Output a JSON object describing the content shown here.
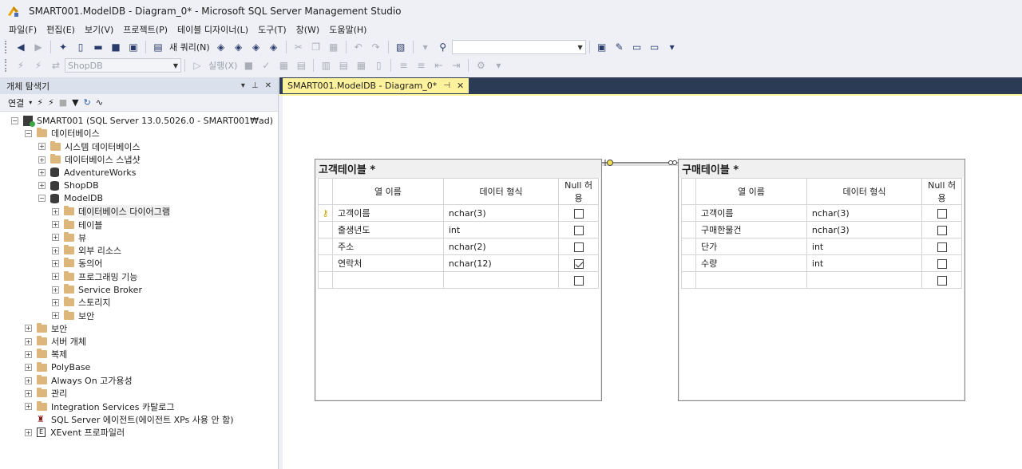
{
  "window": {
    "title": "SMART001.ModelDB - Diagram_0* - Microsoft SQL Server Management Studio"
  },
  "menu": [
    "파일(F)",
    "편집(E)",
    "보기(V)",
    "프로젝트(P)",
    "테이블 디자이너(L)",
    "도구(T)",
    "창(W)",
    "도움말(H)"
  ],
  "toolbar": {
    "new_query_label": "새 쿼리(N)",
    "database_combo": "ShopDB",
    "execute_label": "실행(X)",
    "search_value": ""
  },
  "object_explorer": {
    "title": "개체 탐색기",
    "connect_label": "연결",
    "tree": [
      {
        "label": "SMART001 (SQL Server 13.0.5026.0 - SMART001₩ad)",
        "level": 0,
        "expander": "-",
        "icon": "server-icon"
      },
      {
        "label": "데이터베이스",
        "level": 1,
        "expander": "-",
        "icon": "folder-icon"
      },
      {
        "label": "시스템 데이터베이스",
        "level": 2,
        "expander": "+",
        "icon": "folder-icon"
      },
      {
        "label": "데이터베이스 스냅샷",
        "level": 2,
        "expander": "+",
        "icon": "folder-icon"
      },
      {
        "label": "AdventureWorks",
        "level": 2,
        "expander": "+",
        "icon": "database-icon"
      },
      {
        "label": "ShopDB",
        "level": 2,
        "expander": "+",
        "icon": "database-icon"
      },
      {
        "label": "ModelDB",
        "level": 2,
        "expander": "-",
        "icon": "database-icon"
      },
      {
        "label": "데이터베이스 다이어그램",
        "level": 3,
        "expander": "+",
        "icon": "folder-icon",
        "selected": true
      },
      {
        "label": "테이블",
        "level": 3,
        "expander": "+",
        "icon": "folder-icon"
      },
      {
        "label": "뷰",
        "level": 3,
        "expander": "+",
        "icon": "folder-icon"
      },
      {
        "label": "외부 리소스",
        "level": 3,
        "expander": "+",
        "icon": "folder-icon"
      },
      {
        "label": "동의어",
        "level": 3,
        "expander": "+",
        "icon": "folder-icon"
      },
      {
        "label": "프로그래밍 기능",
        "level": 3,
        "expander": "+",
        "icon": "folder-icon"
      },
      {
        "label": "Service Broker",
        "level": 3,
        "expander": "+",
        "icon": "folder-icon"
      },
      {
        "label": "스토리지",
        "level": 3,
        "expander": "+",
        "icon": "folder-icon"
      },
      {
        "label": "보안",
        "level": 3,
        "expander": "+",
        "icon": "folder-icon"
      },
      {
        "label": "보안",
        "level": 1,
        "expander": "+",
        "icon": "folder-icon"
      },
      {
        "label": "서버 개체",
        "level": 1,
        "expander": "+",
        "icon": "folder-icon"
      },
      {
        "label": "복제",
        "level": 1,
        "expander": "+",
        "icon": "folder-icon"
      },
      {
        "label": "PolyBase",
        "level": 1,
        "expander": "+",
        "icon": "folder-icon"
      },
      {
        "label": "Always On 고가용성",
        "level": 1,
        "expander": "+",
        "icon": "folder-icon"
      },
      {
        "label": "관리",
        "level": 1,
        "expander": "+",
        "icon": "folder-icon"
      },
      {
        "label": "Integration Services 카탈로그",
        "level": 1,
        "expander": "+",
        "icon": "folder-icon"
      },
      {
        "label": "SQL Server 에이전트(에이전트 XPs 사용 안 함)",
        "level": 1,
        "expander": "",
        "icon": "agent-icon"
      },
      {
        "label": "XEvent 프로파일러",
        "level": 1,
        "expander": "+",
        "icon": "xevent-icon"
      }
    ]
  },
  "document_tab": {
    "label": "SMART001.ModelDB - Diagram_0*"
  },
  "diagram": {
    "headers": {
      "col_name": "열 이름",
      "data_type": "데이터 형식",
      "allow_null": "Null 허용"
    },
    "tables": [
      {
        "title": "고객테이블 *",
        "rows": [
          {
            "name": "고객이름",
            "type": "nchar(3)",
            "null": false,
            "key": true
          },
          {
            "name": "출생년도",
            "type": "int",
            "null": false,
            "key": false
          },
          {
            "name": "주소",
            "type": "nchar(2)",
            "null": false,
            "key": false
          },
          {
            "name": "연락처",
            "type": "nchar(12)",
            "null": true,
            "key": false
          },
          {
            "name": "",
            "type": "",
            "null": false,
            "key": false
          }
        ]
      },
      {
        "title": "구매테이블 *",
        "rows": [
          {
            "name": "고객이름",
            "type": "nchar(3)",
            "null": false,
            "key": false
          },
          {
            "name": "구매한물건",
            "type": "nchar(3)",
            "null": false,
            "key": false
          },
          {
            "name": "단가",
            "type": "int",
            "null": false,
            "key": false
          },
          {
            "name": "수량",
            "type": "int",
            "null": false,
            "key": false
          },
          {
            "name": "",
            "type": "",
            "null": false,
            "key": false
          }
        ]
      }
    ]
  }
}
